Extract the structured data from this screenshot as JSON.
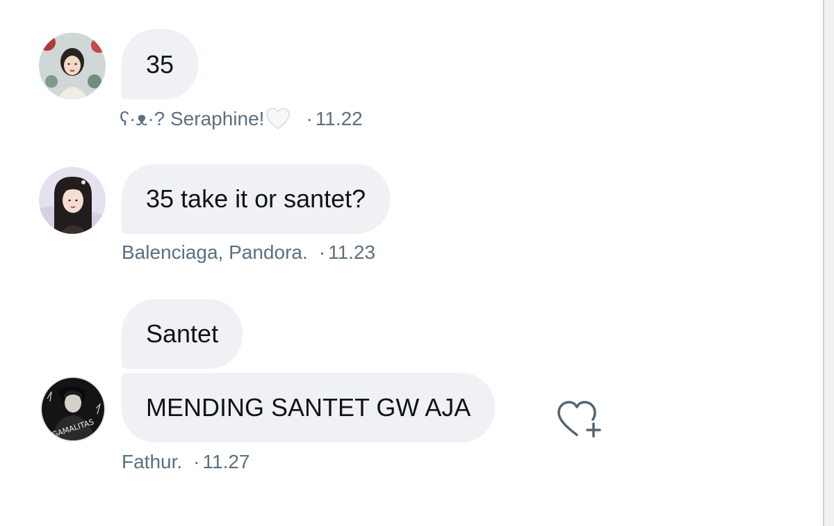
{
  "messages": [
    {
      "text": "35",
      "sender": "ʕ·ᴥ·? Seraphine!",
      "sender_emoji": "white-heart",
      "time": "11.22"
    },
    {
      "text": "35 take it or santet?",
      "sender": "Balenciaga, Pandora.",
      "time": "11.23"
    },
    {
      "texts": [
        "Santet",
        "MENDING SANTET GW AJA"
      ],
      "sender": "Fathur.",
      "time": "11.27",
      "avatar_text": "GAMALITAS"
    }
  ],
  "meta_separator": "·",
  "actions": {
    "react_icon": "heart-plus-icon"
  },
  "colors": {
    "bubble_bg": "#eff1f4",
    "meta_text": "#5b6f80",
    "icon_stroke": "#536471"
  }
}
